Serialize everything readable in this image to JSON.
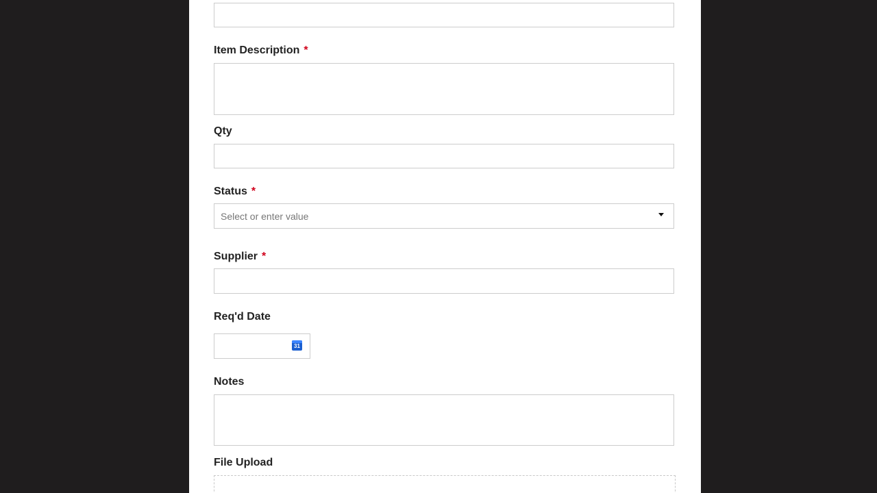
{
  "form": {
    "item_description": {
      "label": "Item Description",
      "required_mark": "*"
    },
    "qty": {
      "label": "Qty"
    },
    "status": {
      "label": "Status",
      "required_mark": "*",
      "placeholder": "Select or enter value"
    },
    "supplier": {
      "label": "Supplier",
      "required_mark": "*"
    },
    "reqd_date": {
      "label": "Req'd Date",
      "calendar_day": "31"
    },
    "notes": {
      "label": "Notes"
    },
    "file_upload": {
      "label": "File Upload"
    }
  },
  "colors": {
    "page_background": "#1f1d1e",
    "panel_background": "#ffffff",
    "required_mark": "#d0021b",
    "calendar_icon": "#1a5fd0"
  },
  "icons": {
    "status_dropdown": "chevron-down-icon",
    "date_picker": "calendar-icon"
  }
}
